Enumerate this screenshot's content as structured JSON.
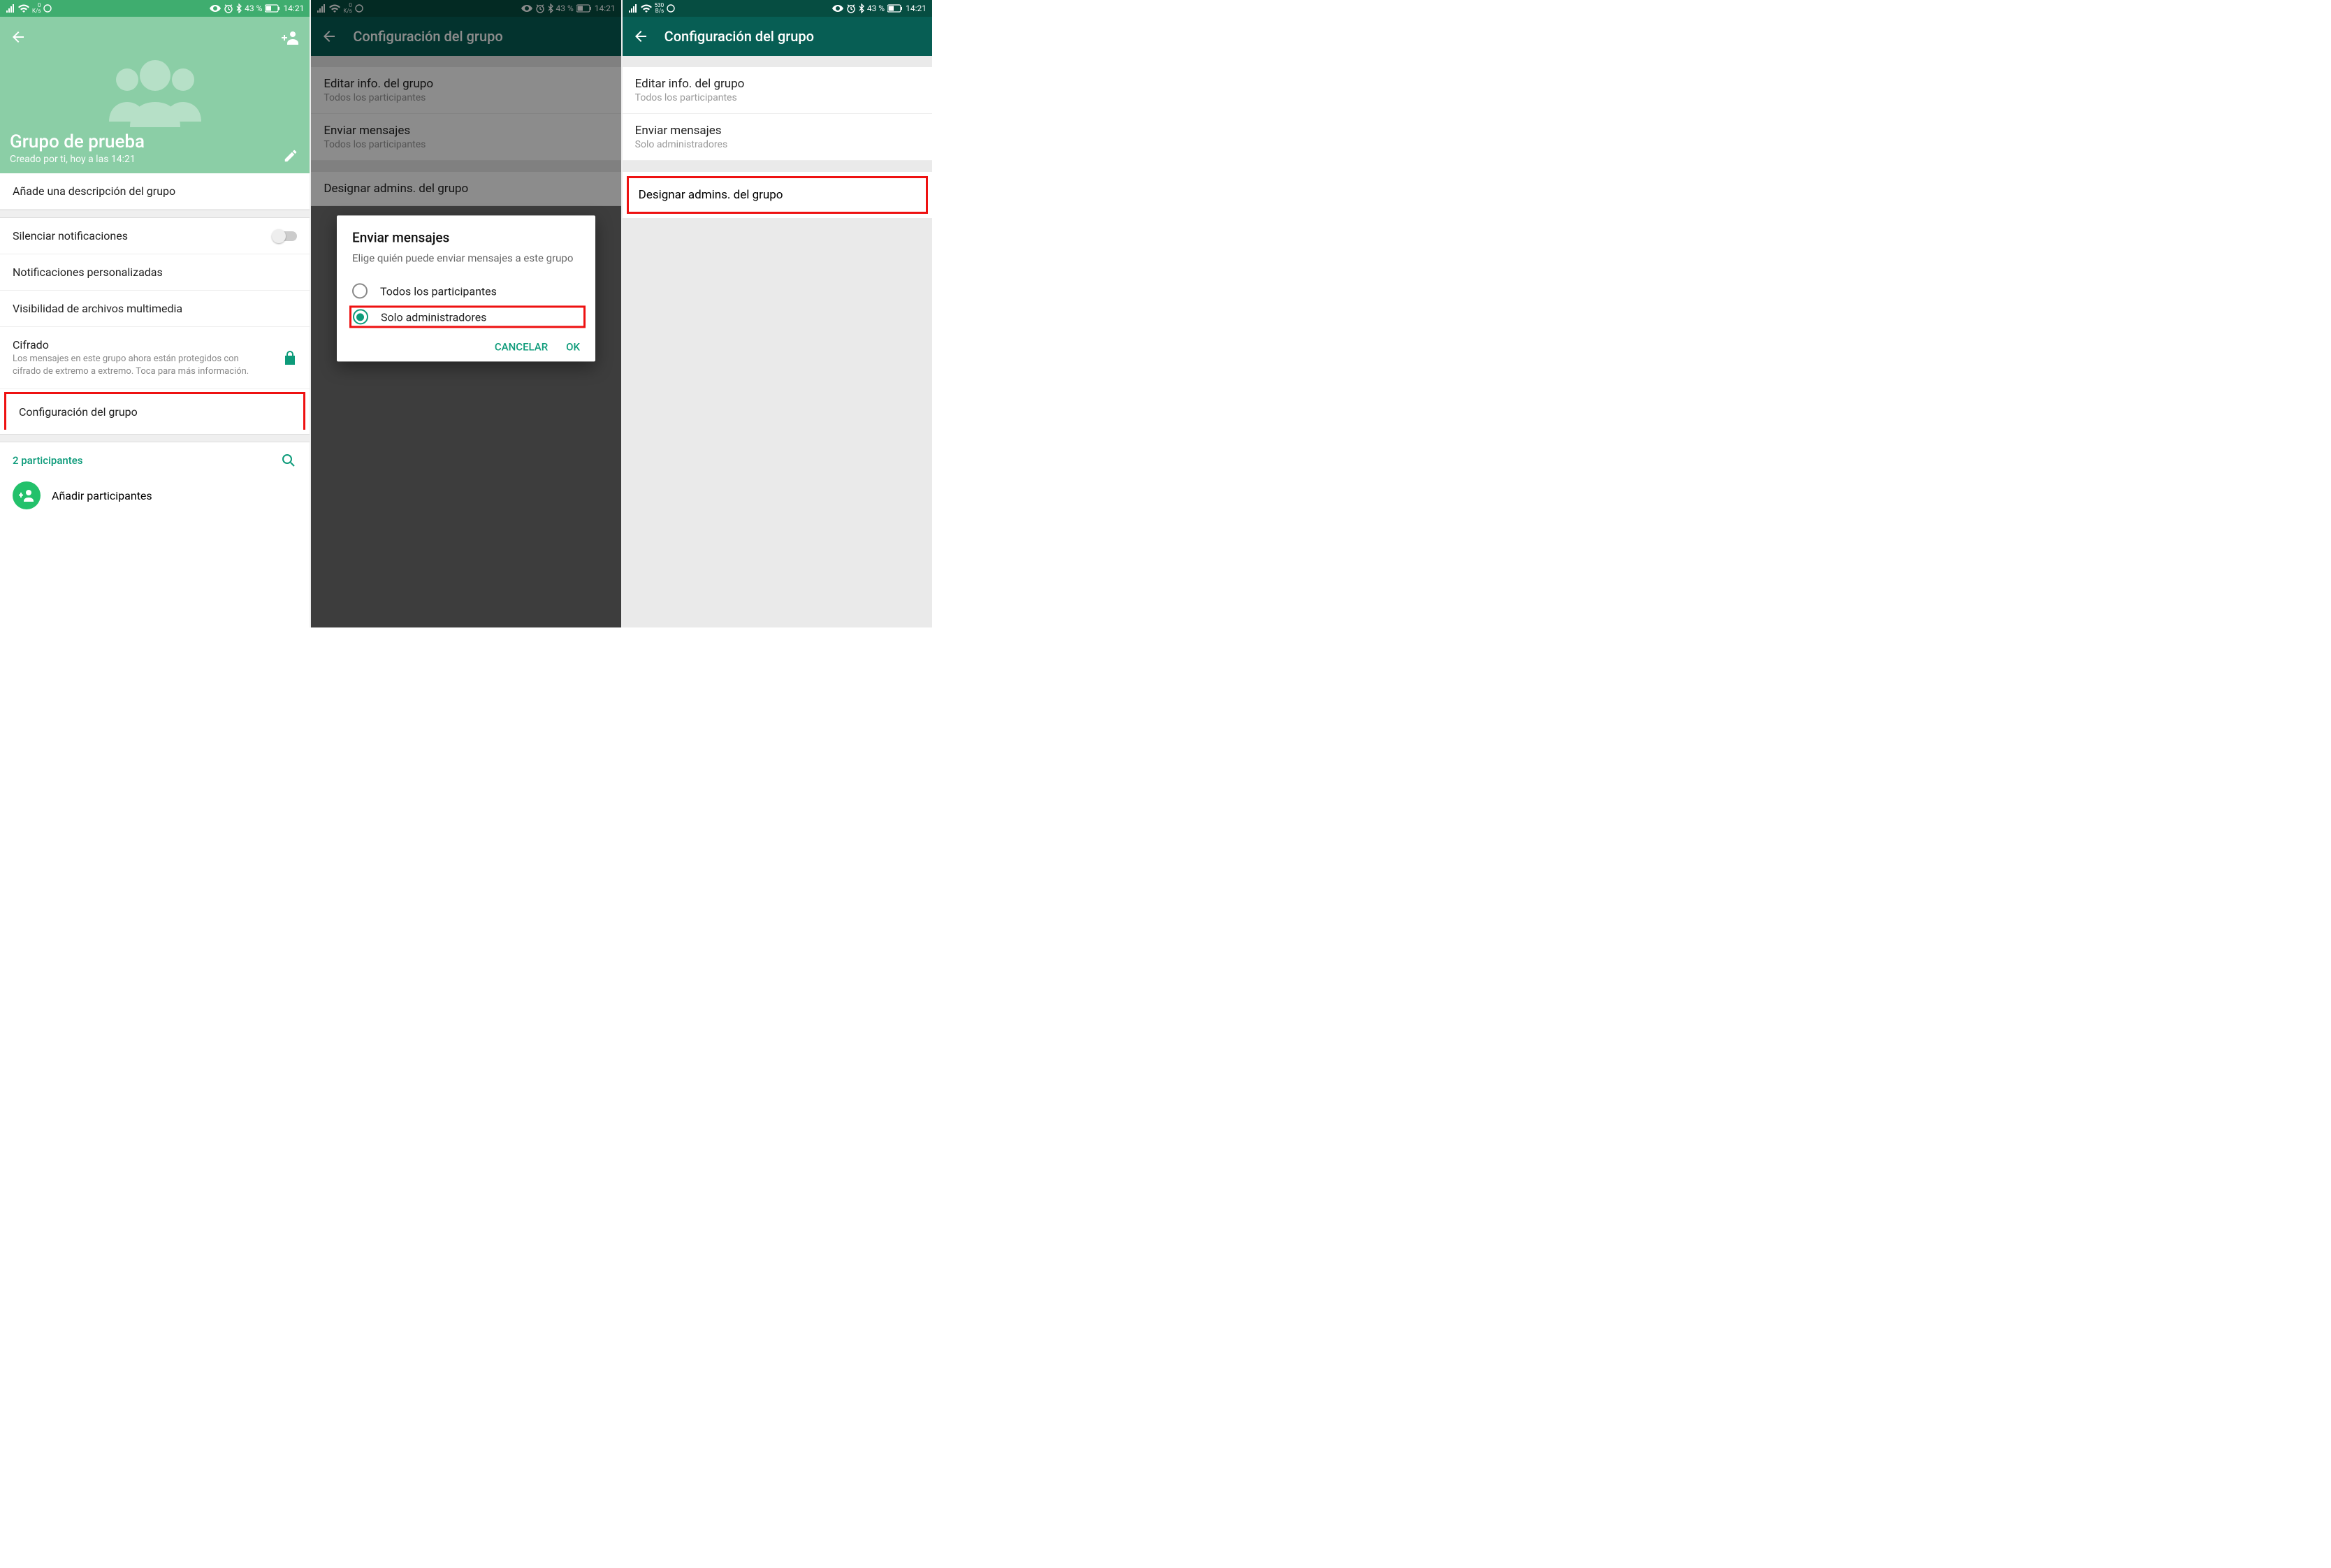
{
  "statusbar": {
    "kbs_zero": "0",
    "kbs_unit": "K/s",
    "bps_530": "530",
    "bps_unit": "B/s",
    "battery": "43 %",
    "time": "14:21"
  },
  "shot1": {
    "group_name": "Grupo de prueba",
    "created": "Creado por ti, hoy a las 14:21",
    "add_desc": "Añade una descripción del grupo",
    "mute": "Silenciar notificaciones",
    "custom_notif": "Notificaciones personalizadas",
    "media_vis": "Visibilidad de archivos multimedia",
    "encryption_title": "Cifrado",
    "encryption_sub": "Los mensajes en este grupo ahora están protegidos con cifrado de extremo a extremo. Toca para más información.",
    "group_settings": "Configuración del grupo",
    "participants": "2 participantes",
    "add_participants": "Añadir participantes"
  },
  "shot2": {
    "title": "Configuración del grupo",
    "edit_info_t": "Editar info. del grupo",
    "edit_info_s": "Todos los participantes",
    "send_msgs_t": "Enviar mensajes",
    "send_msgs_s": "Todos los participantes",
    "designate_t": "Designar admins. del grupo",
    "dialog_title": "Enviar mensajes",
    "dialog_desc": "Elige quién puede enviar mensajes a este grupo",
    "opt_all": "Todos los participantes",
    "opt_admins": "Solo administradores",
    "cancel": "CANCELAR",
    "ok": "OK"
  },
  "shot3": {
    "title": "Configuración del grupo",
    "edit_info_t": "Editar info. del grupo",
    "edit_info_s": "Todos los participantes",
    "send_msgs_t": "Enviar mensajes",
    "send_msgs_s": "Solo administradores",
    "designate_t": "Designar admins. del grupo"
  }
}
